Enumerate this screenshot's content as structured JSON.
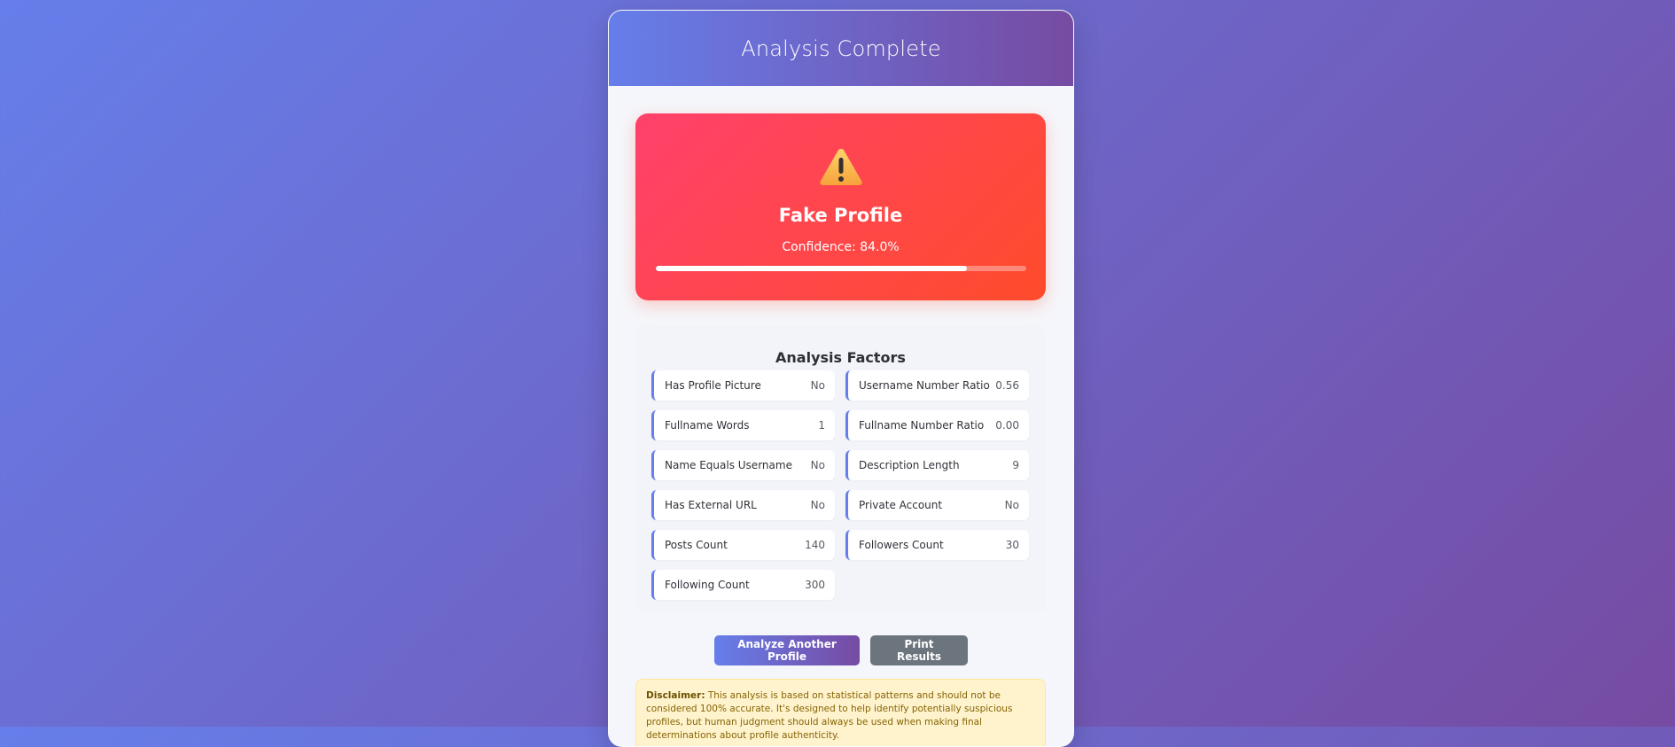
{
  "header": {
    "title": "Analysis Complete"
  },
  "result": {
    "icon": "warning-icon",
    "verdict": "Fake Profile",
    "confidence_label": "Confidence: 84.0%",
    "confidence_value": 84.0,
    "accent_color": "#ff416c"
  },
  "factors": {
    "title": "Analysis Factors",
    "items": [
      {
        "label": "Has Profile Picture",
        "value": "No"
      },
      {
        "label": "Username Number Ratio",
        "value": "0.56"
      },
      {
        "label": "Fullname Words",
        "value": "1"
      },
      {
        "label": "Fullname Number Ratio",
        "value": "0.00"
      },
      {
        "label": "Name Equals Username",
        "value": "No"
      },
      {
        "label": "Description Length",
        "value": "9"
      },
      {
        "label": "Has External URL",
        "value": "No"
      },
      {
        "label": "Private Account",
        "value": "No"
      },
      {
        "label": "Posts Count",
        "value": "140"
      },
      {
        "label": "Followers Count",
        "value": "30"
      },
      {
        "label": "Following Count",
        "value": "300"
      }
    ]
  },
  "actions": {
    "analyze_label": "Analyze Another Profile",
    "print_label": "Print Results"
  },
  "disclaimer": {
    "label": "Disclaimer:",
    "text": " This analysis is based on statistical patterns and should not be considered 100% accurate. It's designed to help identify potentially suspicious profiles, but human judgment should always be used when making final determinations about profile authenticity."
  }
}
